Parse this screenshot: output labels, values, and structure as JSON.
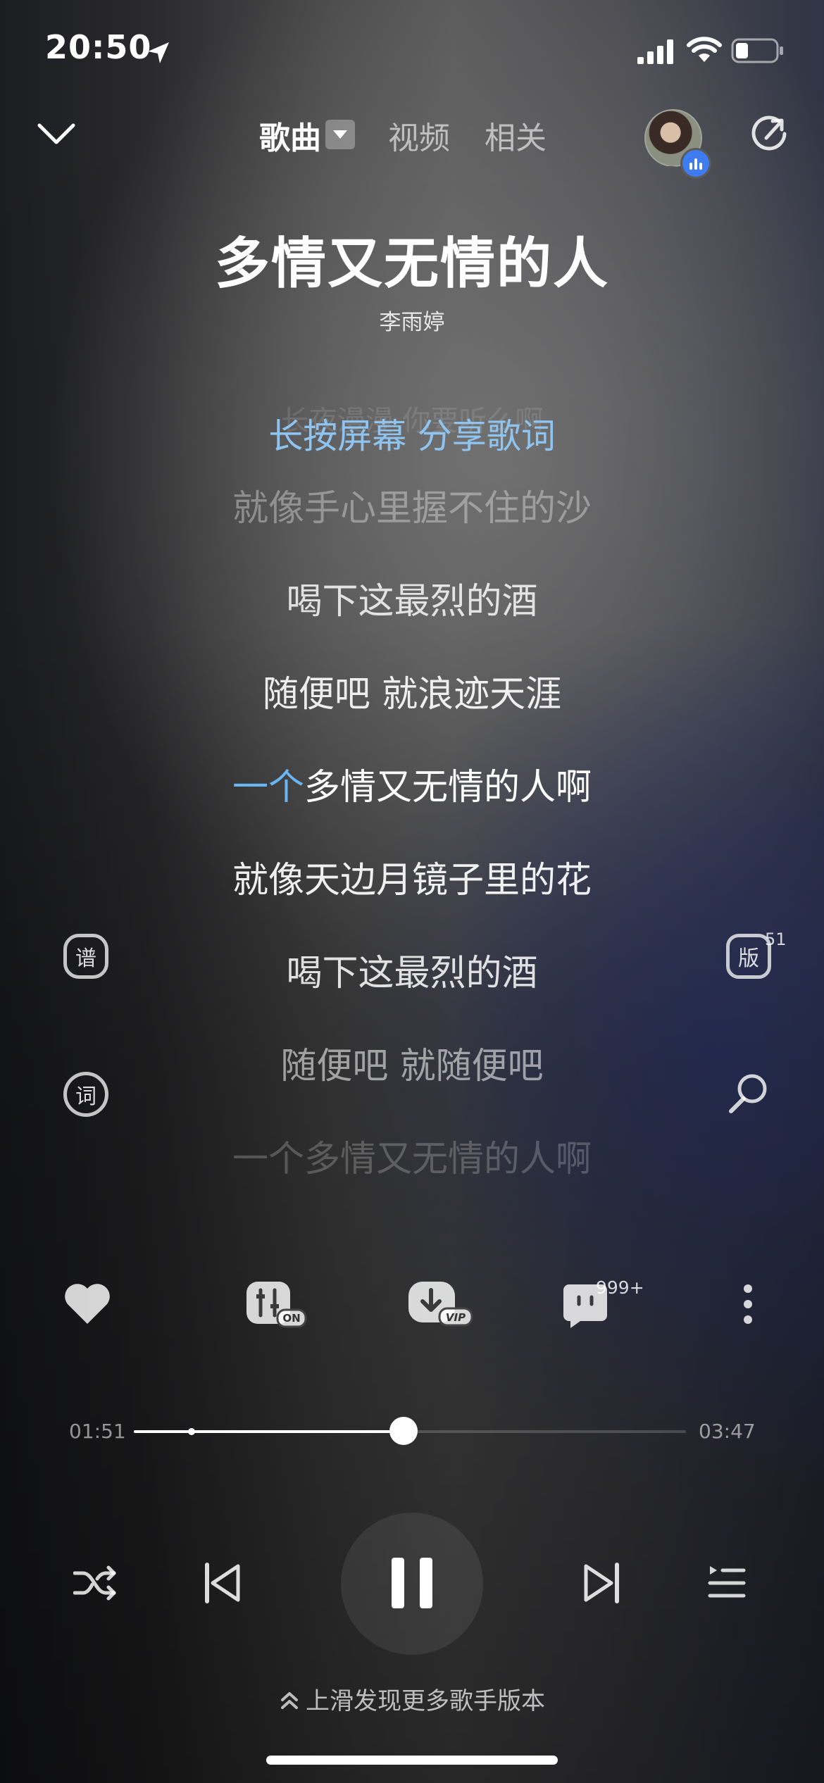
{
  "status_bar": {
    "time": "20:50",
    "battery_level": 0.3
  },
  "header": {
    "tabs": [
      {
        "label": "歌曲",
        "active": true
      },
      {
        "label": "视频",
        "active": false
      },
      {
        "label": "相关",
        "active": false
      }
    ]
  },
  "song": {
    "title": "多情又无情的人",
    "artist": "李雨婷"
  },
  "lyrics": {
    "hint_prefix": "长按屏幕 ",
    "hint_action": "分享歌词",
    "ghost_line": "长夜漫漫 你要听么啊",
    "lines": [
      "就像手心里握不住的沙",
      "喝下这最烈的酒",
      "随便吧 就浪迹天涯",
      "多情又无情的人啊",
      "就像天边月镜子里的花",
      "喝下这最烈的酒",
      "随便吧 就随便吧",
      "一个多情又无情的人啊"
    ],
    "current_sung": "一个",
    "highlight_color": "#6ab6f2"
  },
  "side_icons": {
    "sheet_label": "谱",
    "version_label": "版",
    "version_count": "51",
    "lyric_label": "词"
  },
  "actions": {
    "toggle_badge": "ON",
    "download_badge": "VIP",
    "comment_count": "999+"
  },
  "player": {
    "elapsed": "01:51",
    "duration": "03:47",
    "progress": 0.488,
    "buffered": 0.104
  },
  "footer": {
    "swipe_hint": "上滑发现更多歌手版本"
  }
}
